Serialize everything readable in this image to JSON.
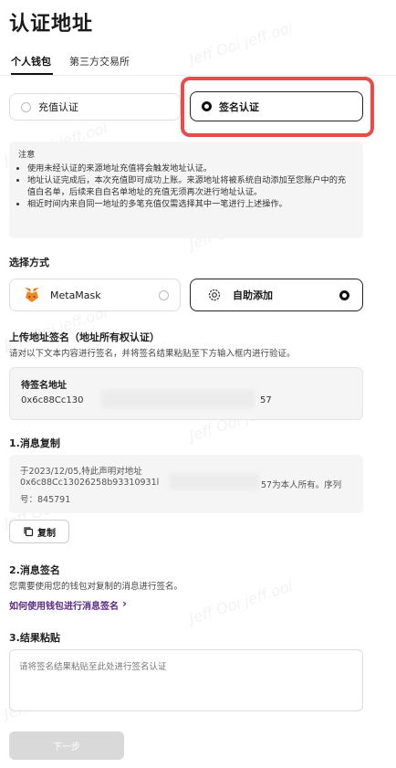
{
  "page_title": "认证地址",
  "tabs": [
    {
      "label": "个人钱包",
      "active": true
    },
    {
      "label": "第三方交易所",
      "active": false
    }
  ],
  "auth_options": {
    "recharge": "充值认证",
    "signature": "签名认证",
    "selected": "signature"
  },
  "note": {
    "title": "注意",
    "items": [
      "使用未经认证的来源地址充值将会触发地址认证。",
      "地址认证完成后，本次充值即可成功上账。来源地址将被系统自动添加至您账户中的充值白名单，后续来自白名单地址的充值无须再次进行地址认证。",
      "相近时间内来自同一地址的多笔充值仅需选择其中一笔进行上述操作。"
    ]
  },
  "method": {
    "heading": "选择方式",
    "metamask": "MetaMask",
    "auto_add": "自助添加",
    "selected": "auto_add"
  },
  "upload": {
    "heading": "上传地址签名（地址所有权认证）",
    "desc": "请对以下文本内容进行签名，并将签名结果粘贴至下方输入框内进行验证。",
    "addr_label": "待签名地址",
    "addr_prefix": "0x6c88Cc130",
    "addr_suffix": "57"
  },
  "step1": {
    "heading": "1.消息复制",
    "msg_line1": "于2023/12/05,特此声明对地址",
    "msg_line2_prefix": "0x6c88Cc13026258b93310931l",
    "msg_line2_suffix": "57为本人所有。序列",
    "msg_line3": "号：845791",
    "copy_label": "复制"
  },
  "step2": {
    "heading": "2.消息签名",
    "desc": "您需要使用您的钱包对复制的消息进行签名。",
    "link": "如何使用钱包进行消息签名",
    "link_arrow": "›"
  },
  "step3": {
    "heading": "3.结果粘贴",
    "placeholder": "请将签名结果粘贴至此处进行签名认证"
  },
  "next_label": "下一步",
  "watermark": "Jeff Ooi jeff.ooi",
  "colors": {
    "highlight": "#e84b4b",
    "link": "#5a2a82",
    "disabled": "#d9d9d9"
  },
  "icons": {
    "copy": "copy-icon",
    "gear": "gear-icon",
    "fox": "metamask-fox-icon"
  }
}
